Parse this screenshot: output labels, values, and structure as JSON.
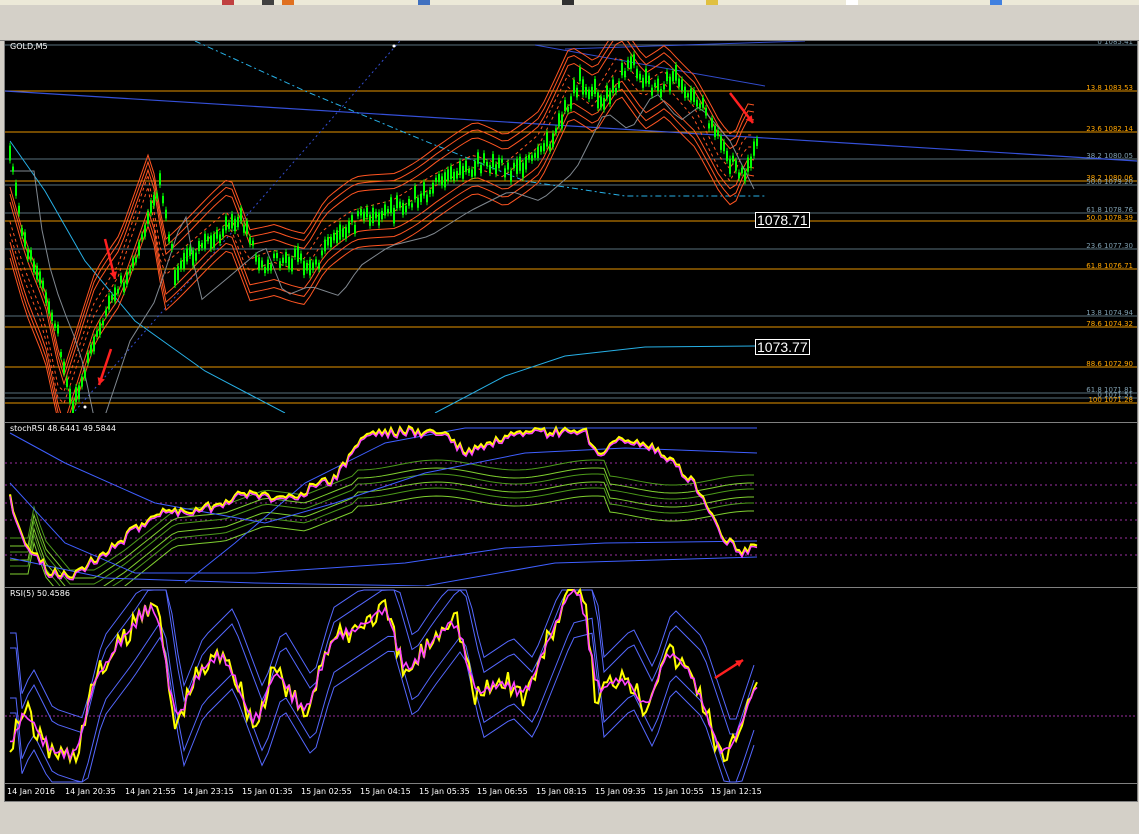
{
  "window": {
    "symbol_label": "GOLD,M5"
  },
  "colors": {
    "background": "#000000",
    "bull_candle": "#00ff00",
    "fib_orange": "#ffa500",
    "fib_gray": "#7f9fb0",
    "bollinger": "#ff5522",
    "trendline": "#3f5fff",
    "ma_cyan": "#27b0e6",
    "stoch_yellow": "#ffff00",
    "stoch_magenta": "#ff44ff",
    "arrow_red": "#ff2020",
    "dotted_purple": "#9a2ea0"
  },
  "price_pane": {
    "price_boxes": [
      "1078.71",
      "1073.77"
    ],
    "fib_labels": [
      {
        "text": "0 1085.41",
        "color": "#7f9fb0"
      },
      {
        "text": "13.8 1083.53",
        "color": "#ffa500"
      },
      {
        "text": "23.6 1082.14",
        "color": "#ffa500"
      },
      {
        "text": "38.2 1080.05",
        "color": "#7f9fb0"
      },
      {
        "text": "38.2 1080.06",
        "color": "#ffa500"
      },
      {
        "text": "50.0 1079.20",
        "color": "#7f9fb0"
      },
      {
        "text": "61.8 1078.76",
        "color": "#7f9fb0"
      },
      {
        "text": "50.0 1078.39",
        "color": "#ffa500"
      },
      {
        "text": "23.6 1077.30",
        "color": "#7f9fb0"
      },
      {
        "text": "61.8 1076.71",
        "color": "#ffa500"
      },
      {
        "text": "13.8 1074.94",
        "color": "#7f9fb0"
      },
      {
        "text": "78.6 1074.32",
        "color": "#ffa500"
      },
      {
        "text": "88.6 1072.90",
        "color": "#ffa500"
      },
      {
        "text": "61.8 1071.81",
        "color": "#7f9fb0"
      },
      {
        "text": "0 1071.51",
        "color": "#7f9fb0"
      },
      {
        "text": "100 1071.28",
        "color": "#ffa500"
      }
    ]
  },
  "stoch_pane": {
    "label": "stochRSI 48.6441 49.5844"
  },
  "rsi_pane": {
    "label": "RSI(5) 50.4586"
  },
  "time_axis": [
    "14 Jan 2016",
    "14 Jan 20:35",
    "14 Jan 21:55",
    "14 Jan 23:15",
    "15 Jan 01:35",
    "15 Jan 02:55",
    "15 Jan 04:15",
    "15 Jan 05:35",
    "15 Jan 06:55",
    "15 Jan 08:15",
    "15 Jan 09:35",
    "15 Jan 10:55",
    "15 Jan 12:15"
  ]
}
